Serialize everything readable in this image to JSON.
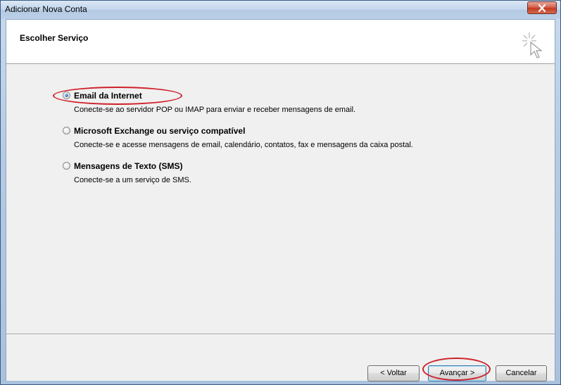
{
  "window": {
    "title": "Adicionar Nova Conta"
  },
  "header": {
    "title": "Escolher Serviço"
  },
  "options": [
    {
      "label": "Email da Internet",
      "description": "Conecte-se ao servidor POP ou IMAP para enviar e receber mensagens de email.",
      "selected": true
    },
    {
      "label": "Microsoft Exchange ou serviço compatível",
      "description": "Conecte-se e acesse mensagens de email, calendário, contatos, fax e mensagens da caixa postal.",
      "selected": false
    },
    {
      "label": "Mensagens de Texto (SMS)",
      "description": "Conecte-se a um serviço de SMS.",
      "selected": false
    }
  ],
  "buttons": {
    "back": "< Voltar",
    "next": "Avançar >",
    "cancel": "Cancelar"
  },
  "icons": {
    "close": "close-icon",
    "wizard": "wizard-cursor-icon",
    "radio": "radio-icon"
  },
  "colors": {
    "highlight": "#d0202a",
    "title_bar": "#c3d6ec",
    "content_bg": "#f0f0f0"
  }
}
